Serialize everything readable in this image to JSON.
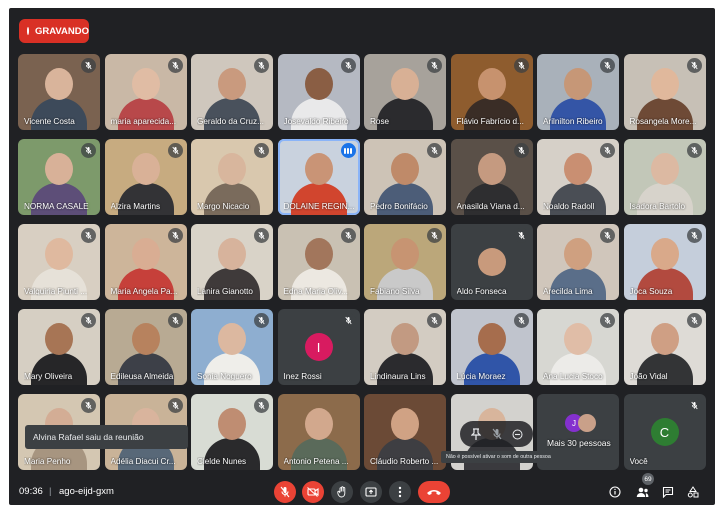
{
  "recording": {
    "label": "GRAVANDO",
    "color": "#d93025"
  },
  "participants": [
    {
      "name": "Vicente Costa",
      "muted": true,
      "bg": "#7a6250",
      "skin": "#d9b49b",
      "cloth": "#3d4a5a"
    },
    {
      "name": "maria aparecida...",
      "muted": true,
      "bg": "#c9b8a6",
      "skin": "#e0bca4",
      "cloth": "#b8484a"
    },
    {
      "name": "Geraldo da Cruz...",
      "muted": true,
      "bg": "#cfc7bd",
      "skin": "#c99a7e",
      "cloth": "#49515c"
    },
    {
      "name": "Josevaldo Ribeiro",
      "muted": true,
      "bg": "#b5b9c2",
      "skin": "#8a5e44",
      "cloth": "#e9e9ea"
    },
    {
      "name": "Rose",
      "muted": true,
      "bg": "#a7a29b",
      "skin": "#d8b095",
      "cloth": "#2b2b2e"
    },
    {
      "name": "Flávio Fabrício d...",
      "muted": true,
      "bg": "#8e5c2e",
      "skin": "#c7926e",
      "cloth": "#3a2d26"
    },
    {
      "name": "Arilnilton Ribeiro",
      "muted": true,
      "bg": "#a9b1ba",
      "skin": "#c69777",
      "cloth": "#3455a6"
    },
    {
      "name": "Rosangela More...",
      "muted": true,
      "bg": "#c7c0b6",
      "skin": "#e0b89c",
      "cloth": "#6e4a36"
    },
    {
      "name": "NORMA CASALE",
      "muted": true,
      "bg": "#7d9a6b",
      "skin": "#d8b198",
      "cloth": "#5d4e78"
    },
    {
      "name": "Alzira Martins",
      "muted": true,
      "bg": "#c7ab80",
      "skin": "#d9b197",
      "cloth": "#333336"
    },
    {
      "name": "Margo Nicacio",
      "muted": true,
      "bg": "#d9c8ae",
      "skin": "#d8b69d",
      "cloth": "#7a6b5c"
    },
    {
      "name": "DOLAINE REGIN...",
      "muted": false,
      "bg": "#c9d2de",
      "skin": "#c99476",
      "cloth": "#d1452e"
    },
    {
      "name": "Pedro Bonifácio",
      "muted": true,
      "bg": "#cdc3b6",
      "skin": "#bf8a69",
      "cloth": "#4c5d78"
    },
    {
      "name": "Anasilda Viana d...",
      "muted": true,
      "bg": "#5a5048",
      "skin": "#c59a80",
      "cloth": "#2e2e30"
    },
    {
      "name": "Noaldo Radoll",
      "muted": true,
      "bg": "#d6d0c8",
      "skin": "#c98f72",
      "cloth": "#4a4e55"
    },
    {
      "name": "Isadora Bartolo",
      "muted": true,
      "bg": "#c2c7b8",
      "skin": "#dcb9a2",
      "cloth": "#d7d3cb"
    },
    {
      "name": "Valquiria Piunti ...",
      "muted": true,
      "bg": "#d8cfc2",
      "skin": "#dfb99f",
      "cloth": "#e6e1d8"
    },
    {
      "name": "Maria Angela Pa...",
      "muted": true,
      "bg": "#cdb59a",
      "skin": "#d9ad93",
      "cloth": "#c6403a"
    },
    {
      "name": "Lanira Gianotto",
      "muted": true,
      "bg": "#d9d3c8",
      "skin": "#d7b39c",
      "cloth": "#3f3a3a"
    },
    {
      "name": "Edna Maria Oliv...",
      "muted": true,
      "bg": "#c9c1b3",
      "skin": "#a2765c",
      "cloth": "#ece8e1"
    },
    {
      "name": "Fabiano Silva",
      "muted": true,
      "bg": "#bba77a",
      "skin": "#c79472",
      "cloth": "#c9c9c9"
    },
    {
      "name": "Aldo Fonseca",
      "muted": true,
      "avatar": "photo",
      "bg": "#3c4043",
      "skin": "#c89a7c",
      "cloth": "#3c4043"
    },
    {
      "name": "Arecilda Lima",
      "muted": true,
      "bg": "#d0c6bb",
      "skin": "#cfa080",
      "cloth": "#5a6e89"
    },
    {
      "name": "Joca Souza",
      "muted": true,
      "bg": "#c5cedb",
      "skin": "#d9a98a",
      "cloth": "#b24a3f"
    },
    {
      "name": "Mary Oliveira",
      "muted": true,
      "bg": "#d6cfc3",
      "skin": "#a77555",
      "cloth": "#262628"
    },
    {
      "name": "Edileusa Almeida",
      "muted": true,
      "bg": "#b8aa93",
      "skin": "#b7825e",
      "cloth": "#3d4048"
    },
    {
      "name": "Sonia Noguero",
      "muted": true,
      "bg": "#8eaed0",
      "skin": "#dcb8a0",
      "cloth": "#efeeea"
    },
    {
      "name": "Inez Rossi",
      "muted": true,
      "avatar": "I",
      "avatar_color": "#d81b60",
      "bg": "#3c4043"
    },
    {
      "name": "Lindinaura Lins",
      "muted": true,
      "bg": "#d3ccc2",
      "skin": "#c29a82",
      "cloth": "#2b2b2e"
    },
    {
      "name": "Lúcia Moraez",
      "muted": true,
      "bg": "#c0c4cd",
      "skin": "#a66d4d",
      "cloth": "#3055a8"
    },
    {
      "name": "Ana Lucia Stoco",
      "muted": true,
      "bg": "#d7d7d2",
      "skin": "#e0bda7",
      "cloth": "#ecebe8"
    },
    {
      "name": "João Vidal",
      "muted": true,
      "bg": "#dedbd6",
      "skin": "#cf9f84",
      "cloth": "#333436"
    },
    {
      "name": "Maria Penho",
      "muted": true,
      "bg": "#d4c7b2",
      "skin": "#d3ad95",
      "cloth": "#a79580"
    },
    {
      "name": "Adélia Diacui Cr...",
      "muted": true,
      "bg": "#c9b398",
      "skin": "#d9b49d",
      "cloth": "#586878"
    },
    {
      "name": "Clelde Nunes",
      "muted": true,
      "bg": "#d8dcd4",
      "skin": "#bf8d72",
      "cloth": "#2a2a2c"
    },
    {
      "name": "Antonio Petena ...",
      "muted": false,
      "bg": "#8c6b4b",
      "skin": "#d2a88d",
      "cloth": "#5a6a5a"
    },
    {
      "name": "Cláudio Roberto ...",
      "muted": false,
      "bg": "#6b4a36",
      "skin": "#d0a284",
      "cloth": "#3e3e42"
    },
    {
      "name": "",
      "muted": false,
      "bg": "#d3d2ce",
      "skin": "#d8b59c",
      "cloth": "#3a3a3e"
    },
    {
      "name": "Mais 30 pessoas",
      "muted": false,
      "avatar": "more",
      "bg": "#3c4043"
    },
    {
      "name": "Você",
      "muted": true,
      "avatar": "C",
      "avatar_color": "#2e7d32",
      "bg": "#3c4043"
    }
  ],
  "more_people": {
    "label": "Mais 30 pessoas",
    "avatar_letter": "J",
    "avatar_color": "#8430ce"
  },
  "toast": {
    "text": "Alvina Rafael saiu da reunião"
  },
  "tooltip": {
    "text": "Não é possível ativar o som de outra pessoa"
  },
  "meeting": {
    "time": "09:36",
    "separator": "|",
    "code": "ago-eijd-gxm"
  },
  "people_count": "69",
  "controls": [
    "mic-off",
    "camera-off",
    "raise-hand",
    "present",
    "more-options",
    "end-call"
  ],
  "right_controls": [
    "info",
    "people",
    "chat",
    "activities"
  ]
}
